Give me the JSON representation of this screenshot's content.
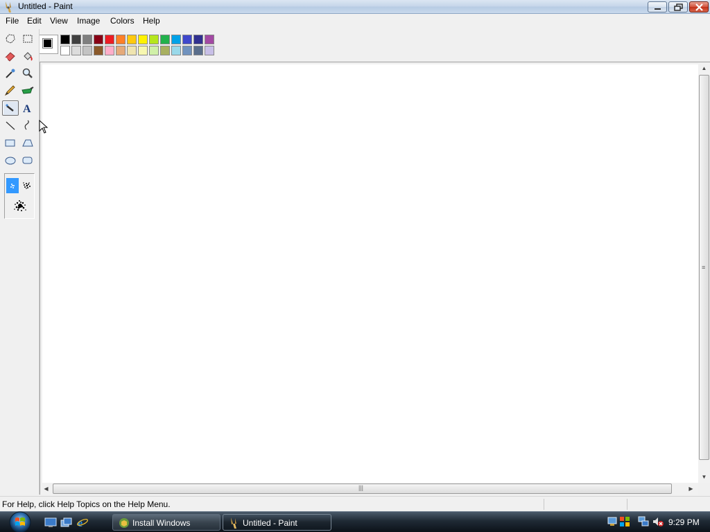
{
  "window": {
    "title": "Untitled - Paint"
  },
  "menu": [
    "File",
    "Edit",
    "View",
    "Image",
    "Colors",
    "Help"
  ],
  "toolbox": {
    "tools": [
      {
        "name": "free-form-select-icon"
      },
      {
        "name": "select-icon"
      },
      {
        "name": "eraser-icon"
      },
      {
        "name": "fill-bucket-icon"
      },
      {
        "name": "pick-color-icon"
      },
      {
        "name": "magnifier-icon"
      },
      {
        "name": "pencil-icon"
      },
      {
        "name": "brush-icon"
      },
      {
        "name": "airbrush-icon",
        "selected": true
      },
      {
        "name": "text-icon",
        "label": "A"
      },
      {
        "name": "line-icon"
      },
      {
        "name": "curve-icon"
      },
      {
        "name": "rectangle-icon"
      },
      {
        "name": "polygon-icon"
      },
      {
        "name": "ellipse-icon"
      },
      {
        "name": "rounded-rectangle-icon"
      }
    ]
  },
  "palette": {
    "foreground": "#000000",
    "background": "#ffffff",
    "row1": [
      "#000000",
      "#404040",
      "#7f7f7f",
      "#880015",
      "#ed1c24",
      "#ff7f27",
      "#ffc90e",
      "#fff200",
      "#b5e61d",
      "#22b14c",
      "#00a2e8",
      "#3f48cc",
      "#303090",
      "#a349a4"
    ],
    "row2": [
      "#ffffff",
      "#dcdcdc",
      "#c3c3c3",
      "#8b5a2b",
      "#ffaec9",
      "#e5aa7a",
      "#efe4b0",
      "#f7f7b0",
      "#d0f0a8",
      "#a8b060",
      "#99d9ea",
      "#7092be",
      "#5a6e8c",
      "#c8bfe7"
    ]
  },
  "status": {
    "text": "For Help, click Help Topics on the Help Menu."
  },
  "taskbar": {
    "buttons": [
      {
        "label": "Install Windows",
        "active": false
      },
      {
        "label": "Untitled - Paint",
        "active": true
      }
    ],
    "clock": "9:29 PM"
  }
}
